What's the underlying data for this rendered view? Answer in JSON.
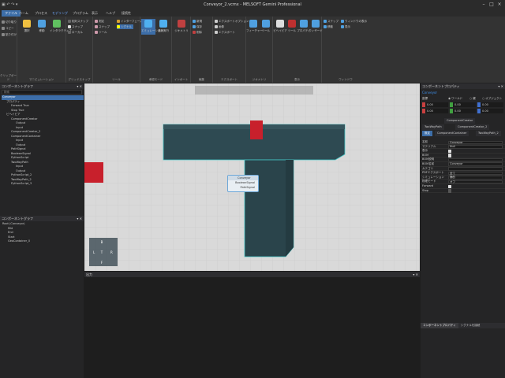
{
  "window": {
    "title": "Conveyor_2.vcmx - MELSOFT Gemini Professional"
  },
  "menus": [
    "ファイル",
    "ホーム",
    "プロセス",
    "モデリング",
    "プログラム",
    "表示",
    "ヘルプ",
    "接続性"
  ],
  "ribbon": {
    "groups": [
      {
        "name": "クリップボード",
        "buttons": [
          "切り取り",
          "コピー",
          "貼り付け"
        ]
      },
      {
        "name": "マニピュレーション",
        "buttons": [
          "選択",
          "移動",
          "インタラクティブ"
        ]
      },
      {
        "name": "グリッドスナップ",
        "buttons": [
          "相対スナップ",
          "スナップ",
          "ローカル"
        ]
      },
      {
        "name": "ツール",
        "buttons": [
          "測定",
          "スナップ",
          "ツール",
          "インターフェース",
          "シグナル"
        ]
      },
      {
        "name": "承認モード",
        "buttons": [
          "エミュレーション",
          "連続実行"
        ]
      },
      {
        "name": "インポート",
        "buttons": [
          "ジオメトリ",
          "インポート"
        ]
      },
      {
        "name": "編集",
        "buttons": [
          "新規",
          "保存",
          "削除"
        ]
      },
      {
        "name": "エクスポート",
        "buttons": [
          "エクスポートオプション",
          "画像",
          "エクスポート"
        ]
      },
      {
        "name": "ジオメトリ",
        "buttons": [
          "フィーチャー",
          "ツール"
        ]
      },
      {
        "name": "表示",
        "buttons": [
          "ビヘイビア",
          "ツール",
          "プロパティ",
          "ウィザード"
        ]
      },
      {
        "name": "ウィンドウ",
        "buttons": [
          "ステップ",
          "移動",
          "ウィンドウの表示",
          "表示"
        ]
      }
    ]
  },
  "left": {
    "component_graph_title": "コンポーネントグラフ",
    "search_placeholder": "検索",
    "tree": [
      "Conveyor",
      "プロパティ",
      "Forward    True",
      "Stop    True",
      "ビヘイビア",
      "ComponentCreator",
      "Output",
      "Input",
      "ComponentCreator_2",
      "ComponentContainer",
      "Input",
      "Output",
      "PathSignal",
      "BooleanSignal",
      "PythonScript",
      "TwoWayPath",
      "Input",
      "Output",
      "PythonScript_2",
      "TwoWayPath_2",
      "PythonScript_3"
    ],
    "scene_title": "コンポーネントグラフ",
    "scene_tree": [
      "Root (Conveyor)",
      "Mid",
      "End",
      "Start",
      "GeoContainer_0"
    ]
  },
  "viewport": {
    "node_title": "Conveyor",
    "node_ports": [
      "BooleanSignal",
      "PathSignal"
    ]
  },
  "output": {
    "title": "出力"
  },
  "right": {
    "title": "コンポーネントプロパティ",
    "component": "Conveyor",
    "coord_label": "座標",
    "coord_options": [
      "ワールド",
      "親",
      "オブジェクト"
    ],
    "xyz": [
      [
        "X",
        "0.00"
      ],
      [
        "Y",
        "0.00"
      ],
      [
        "Z",
        "0.00"
      ],
      [
        "Rx",
        "0.00"
      ],
      [
        "Ry",
        "0.00"
      ],
      [
        "Rz",
        "0.00"
      ]
    ],
    "tabs": [
      "ComponentCreator",
      "TwoWayPath",
      "ComponentCreator_2",
      "既定",
      "ComponentContainer",
      "TwoWayPath_2"
    ],
    "props": [
      {
        "k": "名前",
        "v": "Conveyor"
      },
      {
        "k": "マテリアル",
        "v": "Null"
      },
      {
        "k": "表示",
        "check": true
      },
      {
        "k": "BOM",
        "check": true
      },
      {
        "k": "BOM説明",
        "v": ""
      },
      {
        "k": "BOM名前",
        "v": "Conveyor"
      },
      {
        "k": "カテゴリ",
        "v": ""
      },
      {
        "k": "PDFエクスポート",
        "v": "全て"
      },
      {
        "k": "シミュレーション",
        "v": "静的"
      },
      {
        "k": "物理モード",
        "v": "オフ"
      },
      {
        "k": "Forward",
        "check": true
      },
      {
        "k": "Stop",
        "check": false
      }
    ],
    "bottom_tabs": [
      "コンポーネントプロパティ",
      "シグナルを接続"
    ]
  },
  "colors": {
    "accent": "#3d6ea8",
    "conveyor": "#2e4a52",
    "red_part": "#c8202c"
  }
}
